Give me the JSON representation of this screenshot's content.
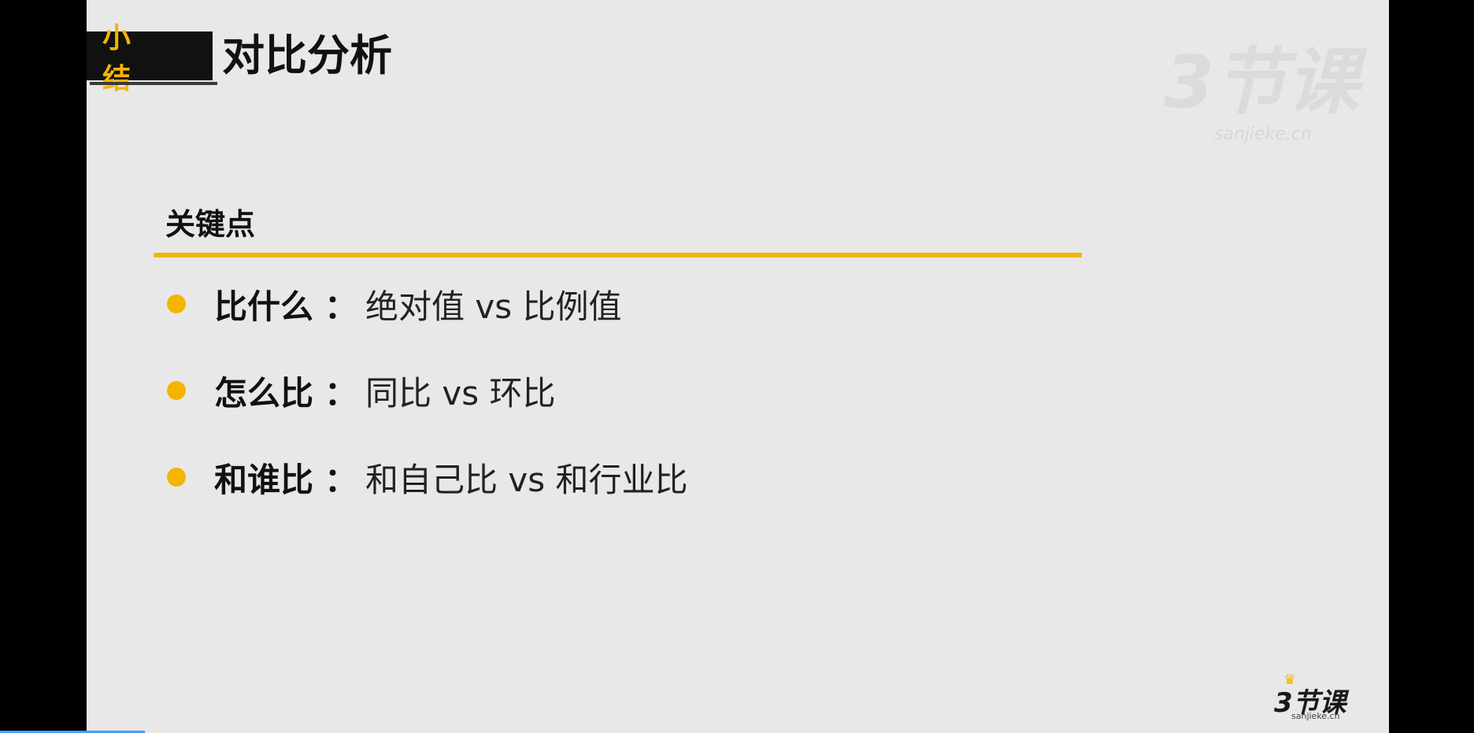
{
  "slide": {
    "tag": "小 结",
    "title": "对比分析",
    "watermark": {
      "main": "3节课",
      "sub": "sanjieke.cn"
    },
    "section_label": "关键点",
    "bullets": [
      {
        "key": "比什么",
        "colon": "：",
        "value": "绝对值 vs 比例值"
      },
      {
        "key": "怎么比",
        "colon": "：",
        "value": "同比 vs 环比"
      },
      {
        "key": "和谁比",
        "colon": "：",
        "value": "和自己比 vs 和行业比"
      }
    ],
    "corner_logo": {
      "main": "3节课",
      "sub": "sanjieke.cn",
      "crown_icon": "crown-icon"
    }
  },
  "colors": {
    "accent": "#f5b400",
    "slide_bg": "#e8e8e8",
    "frame_bg": "#000000",
    "text": "#111111"
  }
}
